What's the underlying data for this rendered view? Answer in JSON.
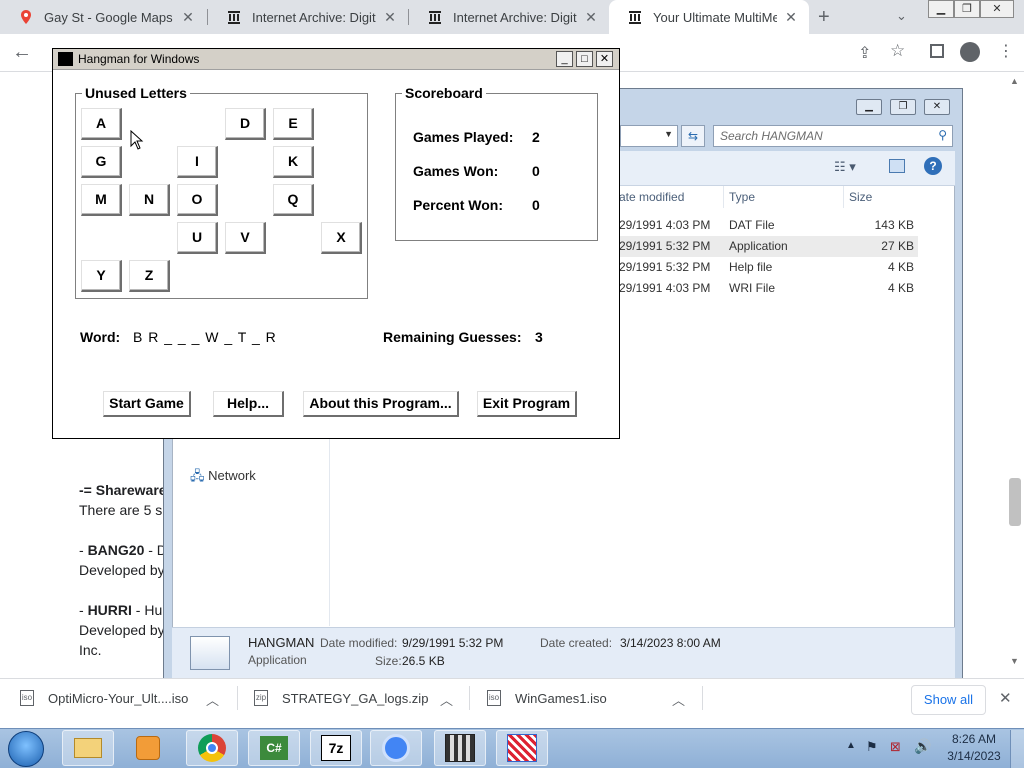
{
  "browser": {
    "tabs": [
      {
        "title": "Gay St - Google Maps",
        "icon": "map-pin-icon",
        "active": false
      },
      {
        "title": "Internet Archive: Digital L",
        "icon": "archive-icon",
        "active": false
      },
      {
        "title": "Internet Archive: Digital L",
        "icon": "archive-icon",
        "active": false
      },
      {
        "title": "Your Ultimate MultiMedia",
        "icon": "archive-icon",
        "active": true
      }
    ],
    "new_tab": "+"
  },
  "page": {
    "shareware_heading": "-= Shareware",
    "shareware_text": "There are 5 s",
    "item1_prefix": "- ",
    "item1_name": "BANG20",
    "item1_rest": " - D",
    "item1_dev": "Developed by",
    "item2_prefix": "- ",
    "item2_name": "HURRI",
    "item2_rest": " - Hu",
    "item2_dev": "Developed by",
    "item2_inc": "Inc."
  },
  "explorer": {
    "search_placeholder": "Search HANGMAN",
    "nav_network": "Network",
    "columns": {
      "date": "ate modified",
      "type": "Type",
      "size": "Size"
    },
    "files": [
      {
        "date": "29/1991 4:03 PM",
        "type": "DAT File",
        "size": "143 KB"
      },
      {
        "date": "29/1991 5:32 PM",
        "type": "Application",
        "size": "27 KB"
      },
      {
        "date": "29/1991 5:32 PM",
        "type": "Help file",
        "size": "4 KB"
      },
      {
        "date": "29/1991 4:03 PM",
        "type": "WRI File",
        "size": "4 KB"
      }
    ],
    "details": {
      "name": "HANGMAN",
      "kind": "Application",
      "modified_label": "Date modified:",
      "modified": "9/29/1991 5:32 PM",
      "created_label": "Date created:",
      "created": "3/14/2023 8:00 AM",
      "size_label": "Size:",
      "size": "26.5 KB"
    }
  },
  "hangman": {
    "title": "Hangman for Windows",
    "unused_letters_label": "Unused Letters",
    "letters": [
      {
        "l": "A",
        "c": 0,
        "r": 0
      },
      {
        "l": "D",
        "c": 3,
        "r": 0
      },
      {
        "l": "E",
        "c": 4,
        "r": 0
      },
      {
        "l": "G",
        "c": 0,
        "r": 1
      },
      {
        "l": "I",
        "c": 2,
        "r": 1
      },
      {
        "l": "K",
        "c": 4,
        "r": 1
      },
      {
        "l": "M",
        "c": 0,
        "r": 2
      },
      {
        "l": "N",
        "c": 1,
        "r": 2
      },
      {
        "l": "O",
        "c": 2,
        "r": 2
      },
      {
        "l": "Q",
        "c": 4,
        "r": 2
      },
      {
        "l": "U",
        "c": 2,
        "r": 3
      },
      {
        "l": "V",
        "c": 3,
        "r": 3
      },
      {
        "l": "X",
        "c": 5,
        "r": 3
      },
      {
        "l": "Y",
        "c": 0,
        "r": 4
      },
      {
        "l": "Z",
        "c": 1,
        "r": 4
      }
    ],
    "scoreboard_label": "Scoreboard",
    "games_played_label": "Games Played:",
    "games_played": "2",
    "games_won_label": "Games Won:",
    "games_won": "0",
    "percent_won_label": "Percent Won:",
    "percent_won": "0",
    "word_label": "Word:",
    "word": "B R _ _ _ W _ T _ R",
    "remaining_label": "Remaining Guesses:",
    "remaining": "3",
    "buttons": {
      "start": "Start Game",
      "help": "Help...",
      "about": "About this Program...",
      "exit": "Exit Program"
    }
  },
  "downloads": {
    "items": [
      {
        "name": "OptiMicro-Your_Ult....iso"
      },
      {
        "name": "STRATEGY_GA_logs.zip"
      },
      {
        "name": "WinGames1.iso"
      }
    ],
    "show_all": "Show all"
  },
  "taskbar": {
    "time": "8:26 AM",
    "date": "3/14/2023",
    "apps": [
      "start-orb-icon",
      "file-explorer-icon",
      "media-player-icon",
      "chrome-icon",
      "csharp-icon",
      "7zip-icon",
      "chrome-icon",
      "film-editor-icon",
      "maze-app-icon"
    ]
  }
}
